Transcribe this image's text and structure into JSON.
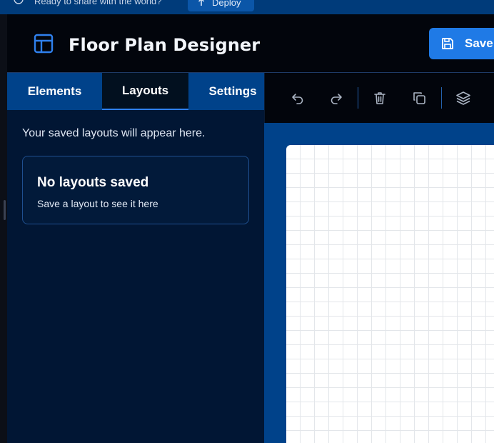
{
  "deploy_bar": {
    "message": "Ready to share with the world?",
    "deploy_label": "Deploy"
  },
  "header": {
    "title": "Floor Plan Designer",
    "save_label": "Save"
  },
  "sidebar": {
    "tabs": [
      {
        "label": "Elements",
        "active": false
      },
      {
        "label": "Layouts",
        "active": true
      },
      {
        "label": "Settings",
        "active": false
      }
    ],
    "intro": "Your saved layouts will appear here.",
    "empty_state": {
      "title": "No layouts saved",
      "subtitle": "Save a layout to see it here"
    }
  },
  "toolbar": {
    "tools": [
      "undo-icon",
      "redo-icon",
      "trash-icon",
      "copy-icon",
      "layers-icon"
    ]
  },
  "colors": {
    "accent": "#1f7ae6",
    "panel": "#00428a",
    "header_bg": "#02050c",
    "sidebar_bg": "#011634"
  }
}
